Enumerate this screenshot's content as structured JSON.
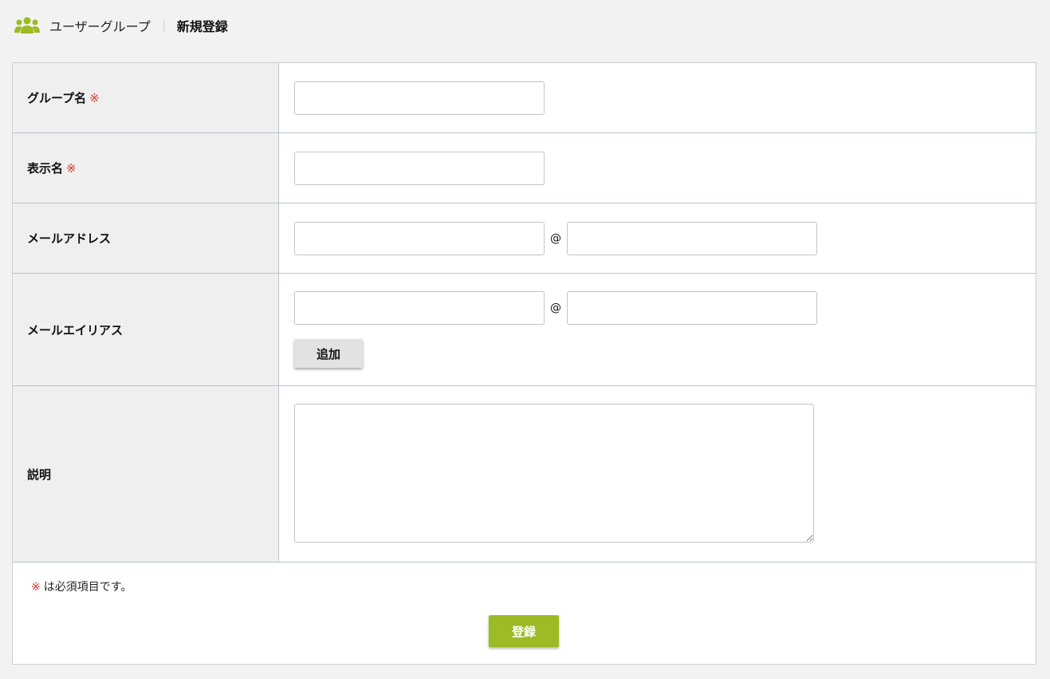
{
  "header": {
    "icon": "users-group-icon",
    "title": "ユーザーグループ",
    "subtitle": "新規登録"
  },
  "colors": {
    "accent": "#9cbb24",
    "required": "#d9362b",
    "label_bg": "#efefef"
  },
  "form": {
    "required_mark": "※",
    "at_sign": "@",
    "fields": {
      "group_name": {
        "label": "グループ名",
        "value": ""
      },
      "display_name": {
        "label": "表示名",
        "value": ""
      },
      "email": {
        "label": "メールアドレス",
        "local": "",
        "domain": ""
      },
      "email_alias": {
        "label": "メールエイリアス",
        "local": "",
        "domain": "",
        "add_label": "追加"
      },
      "description": {
        "label": "説明",
        "value": ""
      }
    },
    "note": "は必須項目です。",
    "submit_label": "登録"
  }
}
